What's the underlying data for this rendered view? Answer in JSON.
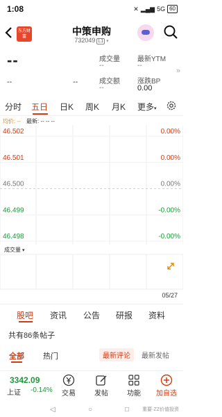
{
  "status_bar": {
    "time": "1:08",
    "battery": "60",
    "signal_text": "5G"
  },
  "header": {
    "logo_text": "东方财富",
    "title": "中策申购",
    "code": "732049",
    "market_tag": "L1"
  },
  "quote": {
    "price": "--",
    "change": "--",
    "change_pct": "--",
    "volume_label": "成交量",
    "volume_value": "--",
    "amount_label": "成交额",
    "amount_value": "--",
    "ytm_label": "最新YTM",
    "ytm_value": "--",
    "bp_label": "涨跌BP",
    "bp_value": "0.00",
    "expand_icon": "double-chevron-right-icon"
  },
  "period_tabs": [
    {
      "label": "分时"
    },
    {
      "label": "五日"
    },
    {
      "label": "日K"
    },
    {
      "label": "周K"
    },
    {
      "label": "月K"
    },
    {
      "label": "更多"
    }
  ],
  "active_period": "五日",
  "settings_icon": "gear-icon",
  "chart_header": {
    "avg_label": "均价: --",
    "latest_label": "最新: -- -- --"
  },
  "chart_data": {
    "type": "line",
    "y_ticks": [
      "46.502",
      "46.501",
      "46.500",
      "46.499",
      "46.498"
    ],
    "pct_ticks": [
      "0.00%",
      "0.00%",
      "0.00%",
      "-0.00%",
      "-0.00%"
    ],
    "ylim": [
      46.498,
      46.502
    ],
    "series": [],
    "x_end_label": "05/27",
    "grid": true,
    "volume_label": "成交量"
  },
  "colors": {
    "accent": "#d23a12",
    "up": "#d23a12",
    "down": "#1a9a3a",
    "neutral": "#777777"
  },
  "section_tabs": [
    {
      "label": "股吧"
    },
    {
      "label": "资讯"
    },
    {
      "label": "公告"
    },
    {
      "label": "研报"
    },
    {
      "label": "资料"
    }
  ],
  "active_section": "股吧",
  "posts_count_text": "共有86条帖子",
  "filter": {
    "all": "全部",
    "hot": "热门",
    "latest_comment": "最新评论",
    "latest_post": "最新发帖"
  },
  "bottom_bar": {
    "index_value": "3342.09",
    "index_name": "上证",
    "index_change": "-0.14%",
    "actions": [
      {
        "label": "交易",
        "icon": "yen-trade-icon"
      },
      {
        "label": "发帖",
        "icon": "edit-post-icon"
      },
      {
        "label": "功能",
        "icon": "grid-apps-icon"
      },
      {
        "label": "加自选",
        "icon": "plus-circle-icon"
      }
    ]
  },
  "watermark": "重要·ZZ价值投资"
}
